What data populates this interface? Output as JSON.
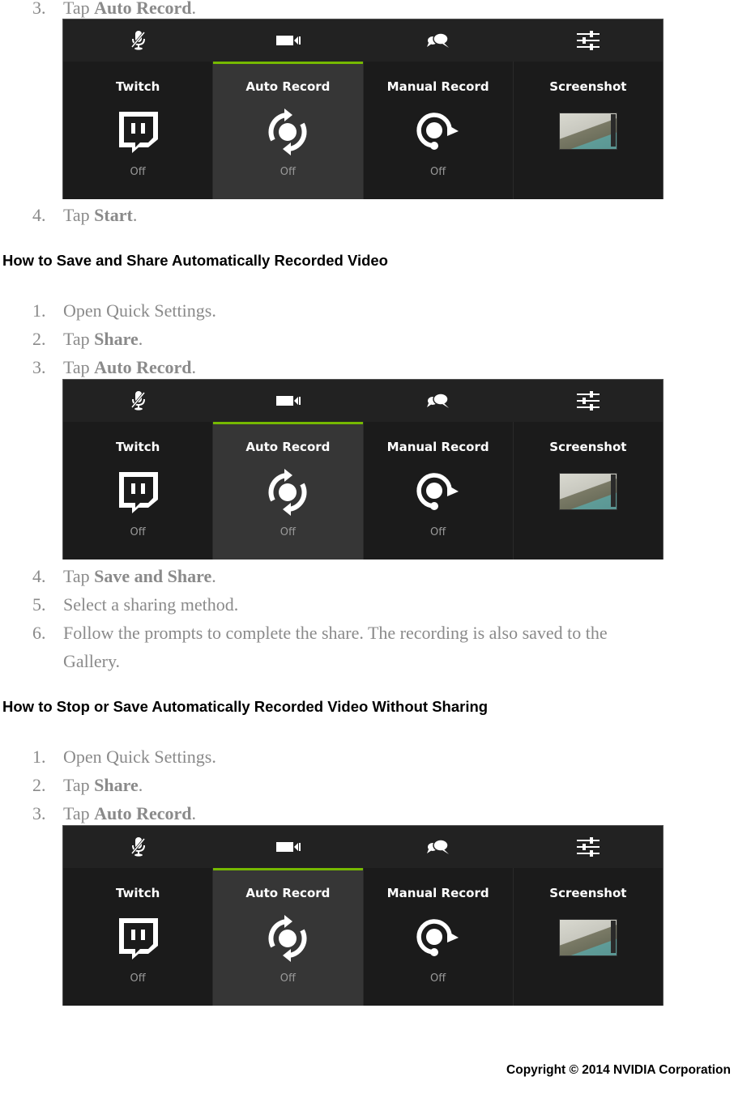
{
  "colors": {
    "accent_green": "#76b900",
    "step_text": "#8a8a8a",
    "heading_text": "#000000",
    "panel_bg": "#1b1b1b",
    "active_tile_bg": "#363636"
  },
  "panel": {
    "top_icons": [
      "mic-muted-icon",
      "video-camera-icon",
      "chat-bubbles-icon",
      "sliders-icon"
    ],
    "tiles": [
      {
        "label": "Twitch",
        "icon": "twitch-icon",
        "state": "Off",
        "active": false
      },
      {
        "label": "Auto Record",
        "icon": "auto-record-icon",
        "state": "Off",
        "active": true
      },
      {
        "label": "Manual Record",
        "icon": "manual-record-icon",
        "state": "Off",
        "active": false
      },
      {
        "label": "Screenshot",
        "icon": "screenshot-thumbnail",
        "state": "",
        "active": false
      }
    ]
  },
  "section0": {
    "steps": [
      {
        "num": "3.",
        "pre": "Tap ",
        "bold": "Auto Record",
        "post": "."
      },
      {
        "num": "4.",
        "pre": "Tap ",
        "bold": "Start",
        "post": "."
      }
    ]
  },
  "section1": {
    "heading": "How to Save and Share Automatically Recorded Video",
    "steps": [
      {
        "num": "1.",
        "pre": "Open Quick Settings.",
        "bold": "",
        "post": ""
      },
      {
        "num": "2.",
        "pre": "Tap ",
        "bold": "Share",
        "post": "."
      },
      {
        "num": "3.",
        "pre": "Tap ",
        "bold": "Auto Record",
        "post": "."
      },
      {
        "num": "4.",
        "pre": "Tap ",
        "bold": "Save and Share",
        "post": "."
      },
      {
        "num": "5.",
        "pre": "Select a sharing method.",
        "bold": "",
        "post": ""
      },
      {
        "num": "6.",
        "pre": "Follow the prompts to complete the share. The recording is also saved to the",
        "bold": "",
        "post": ""
      },
      {
        "num": "",
        "pre": "Gallery.",
        "bold": "",
        "post": ""
      }
    ]
  },
  "section2": {
    "heading": "How to Stop or Save Automatically Recorded Video Without Sharing",
    "steps": [
      {
        "num": "1.",
        "pre": "Open Quick Settings.",
        "bold": "",
        "post": ""
      },
      {
        "num": "2.",
        "pre": "Tap ",
        "bold": "Share",
        "post": "."
      },
      {
        "num": "3.",
        "pre": "Tap ",
        "bold": "Auto Record",
        "post": "."
      }
    ]
  },
  "footer": {
    "copyright": "Copyright © 2014 NVIDIA Corporation"
  }
}
